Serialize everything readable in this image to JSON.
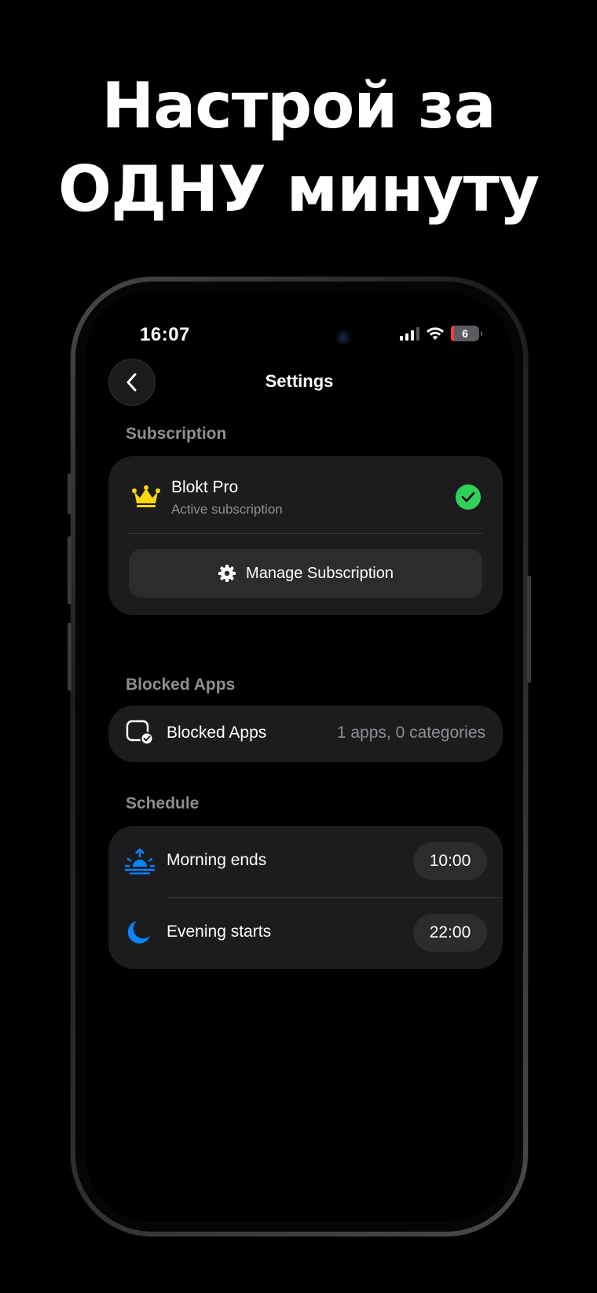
{
  "headline": {
    "line1": "Настрой за",
    "line2": "ОДНУ минуту"
  },
  "status_bar": {
    "time": "16:07",
    "battery": "6"
  },
  "nav": {
    "title": "Settings"
  },
  "subscription": {
    "section_title": "Subscription",
    "plan_name": "Blokt Pro",
    "plan_status": "Active subscription",
    "manage_label": "Manage Subscription"
  },
  "blocked_apps": {
    "section_title": "Blocked Apps",
    "row_label": "Blocked Apps",
    "row_value": "1 apps, 0 categories"
  },
  "schedule": {
    "section_title": "Schedule",
    "rows": [
      {
        "label": "Morning ends",
        "time": "10:00",
        "icon": "sunrise-icon"
      },
      {
        "label": "Evening starts",
        "time": "22:00",
        "icon": "moon-icon"
      }
    ]
  },
  "colors": {
    "accent_blue": "#0a84ff",
    "success_green": "#30d158",
    "crown_yellow": "#ffd60a",
    "card_bg": "#1c1c1e"
  }
}
